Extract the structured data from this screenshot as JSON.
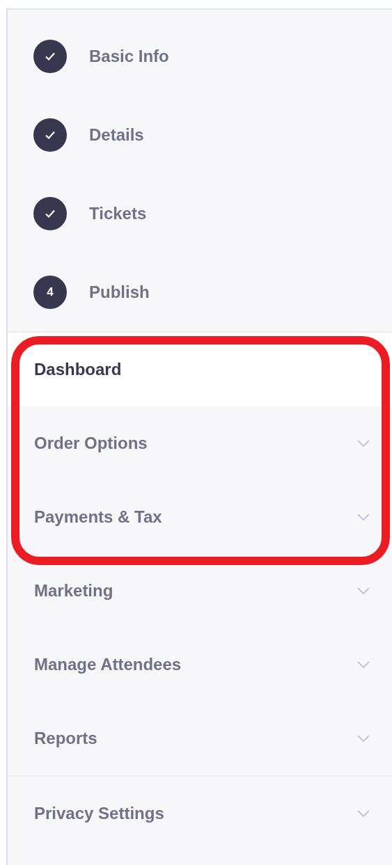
{
  "steps": [
    {
      "label": "Basic Info",
      "kind": "done"
    },
    {
      "label": "Details",
      "kind": "done"
    },
    {
      "label": "Tickets",
      "kind": "done"
    },
    {
      "label": "Publish",
      "kind": "current",
      "number": "4"
    }
  ],
  "nav_sections": [
    {
      "items": [
        {
          "label": "Dashboard",
          "selected": true,
          "expandable": false,
          "highlighted": true
        },
        {
          "label": "Order Options",
          "selected": false,
          "expandable": true,
          "highlighted": true
        },
        {
          "label": "Payments & Tax",
          "selected": false,
          "expandable": true,
          "highlighted": true
        },
        {
          "label": "Marketing",
          "selected": false,
          "expandable": true,
          "highlighted": false
        },
        {
          "label": "Manage Attendees",
          "selected": false,
          "expandable": true,
          "highlighted": false
        },
        {
          "label": "Reports",
          "selected": false,
          "expandable": true,
          "highlighted": false
        }
      ]
    },
    {
      "items": [
        {
          "label": "Privacy Settings",
          "selected": false,
          "expandable": true,
          "highlighted": false
        }
      ]
    }
  ]
}
